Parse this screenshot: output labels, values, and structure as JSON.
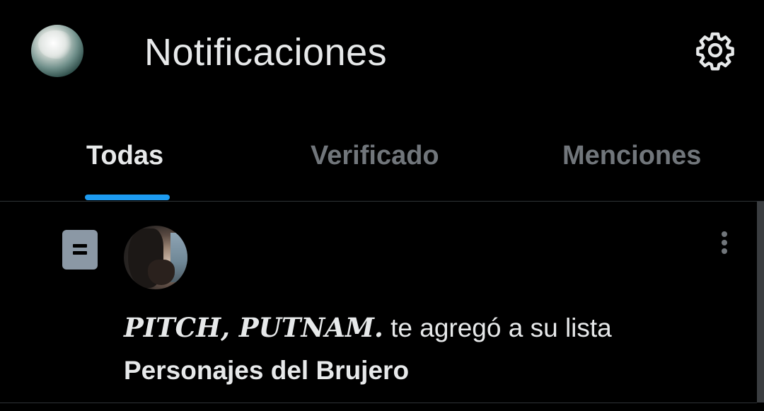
{
  "header": {
    "title": "Notificaciones",
    "avatar_icon": "profile-avatar",
    "settings_icon": "gear-icon"
  },
  "tabs": [
    {
      "label": "Todas",
      "active": true
    },
    {
      "label": "Verificado",
      "active": false
    },
    {
      "label": "Menciones",
      "active": false
    }
  ],
  "notification": {
    "type_icon": "list-icon",
    "user_name": "PITCH, PUTNAM.",
    "action_text": " te agregó a su lista",
    "list_name": "Personajes del Brujero",
    "more_icon": "more-vertical-icon"
  },
  "colors": {
    "background": "#000000",
    "text_primary": "#e7e9ea",
    "text_secondary": "#71767b",
    "accent": "#1d9bf0",
    "divider": "#2f3336"
  }
}
